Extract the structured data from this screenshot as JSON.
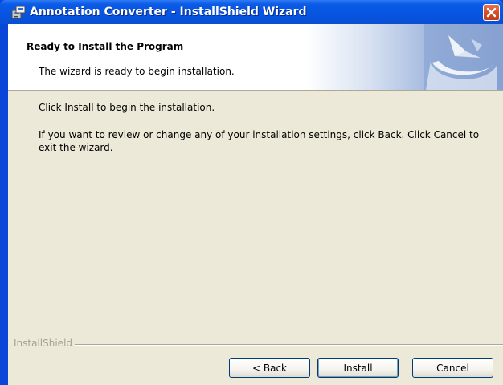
{
  "window": {
    "title": "Annotation Converter - InstallShield Wizard"
  },
  "banner": {
    "title": "Ready to Install the Program",
    "subtitle": "The wizard is ready to begin installation."
  },
  "body": {
    "line1": "Click Install to begin the installation.",
    "line2": "If you want to review or change any of your installation settings, click Back. Click Cancel to exit the wizard."
  },
  "footer": {
    "brand": "InstallShield"
  },
  "buttons": {
    "back": "< Back",
    "install": "Install",
    "cancel": "Cancel"
  },
  "colors": {
    "titlebar": "#0654e0",
    "client_bg": "#ece9d8",
    "close_button": "#d4502a"
  },
  "icons": {
    "app_icon": "installer-icon",
    "close_icon": "close-icon",
    "banner_art": "installshield-logo"
  }
}
